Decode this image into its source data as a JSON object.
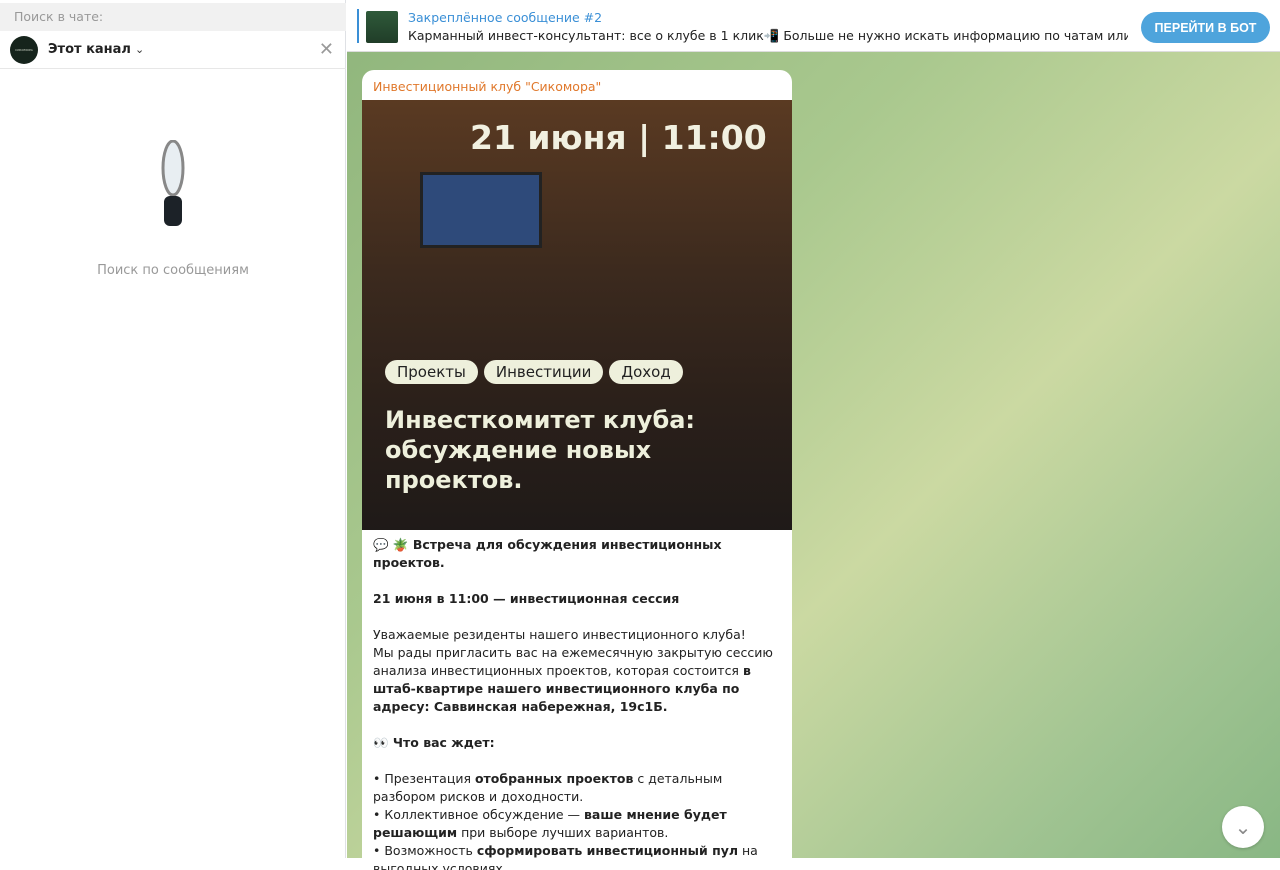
{
  "left": {
    "search_label": "Поиск в чате:",
    "scope": "Этот канал",
    "avatar_text": "СИКОМОРА",
    "empty_text": "Поиск по сообщениям"
  },
  "pinned": {
    "title": "Закреплённое сообщение #2",
    "text": "Карманный инвест-консультант: все о клубе в 1 клик📲 Больше не нужно искать информацию по чатам или пр...",
    "button": "ПЕРЕЙТИ В БОТ"
  },
  "message": {
    "author": "Инвестиционный клуб \"Сикомора\"",
    "image": {
      "date": "21 июня | 11:00",
      "tags": [
        "Проекты",
        "Инвестиции",
        "Доход"
      ],
      "headline": "Инвесткомитет клуба: обсуждение новых проектов."
    },
    "p1": "💬 🪴 Встреча для обсуждения инвестиционных проектов.",
    "p2": "21 июня в 11:00 — инвестиционная сессия",
    "p3a": "Уважаемые резиденты нашего инвестиционного клуба!",
    "p3b": "Мы рады пригласить вас на ежемесячную закрытую сессию анализа инвестиционных проектов, которая состоится ",
    "p3c": "в штаб-квартире нашего инвестиционного клуба по адресу: Саввинская набережная, 19с1Б.",
    "p4": "👀 Что вас ждет:",
    "b1a": "• Презентация ",
    "b1b": "отобранных проектов",
    "b1c": " с детальным разбором рисков и доходности.",
    "b2a": "• Коллективное обсуждение — ",
    "b2b": "ваше мнение будет решающим",
    "b2c": " при выборе лучших вариантов.",
    "b3a": "• Возможность ",
    "b3b": "сформировать инвестиционный пул",
    "b3c": " на выгодных условиях."
  }
}
